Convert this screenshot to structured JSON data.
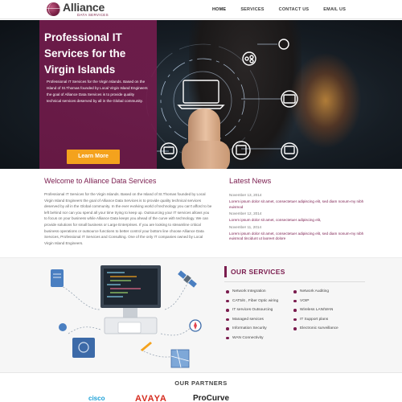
{
  "brand": {
    "name": "Alliance",
    "tagline": "DATA SERVICES",
    "accent": "#7a1c4e",
    "button_color": "#f4a21d"
  },
  "nav": {
    "items": [
      "HOME",
      "SERVICES",
      "CONTACT US",
      "EMAIL US"
    ]
  },
  "hero": {
    "title": "Professional IT Services for the Virgin Islands",
    "text": "Professional IT Services for the Virgin Islands. Based on the Island of St.Thomas founded by Local Virgin Island Engineers the goal of Alliance Data Services is to provide quality technical services deserved by all in the Global community.",
    "button": "Learn More",
    "slides": 5,
    "active_slide": 1
  },
  "welcome": {
    "title": "Welcome to Alliance Data Services",
    "text": "Professional IT Services for the Virgin Islands. Based on the Island of St.Thomas founded by Local Virgin Island Engineers the goal of Alliance Data Services is to provide quality technical services deserved by all in the Global community. In the ever evolving world of technology you can't afford to be left behind nor can you spend all your time trying to keep up. Outsourcing your IT services allows you to focus on your business while Alliance Data keeps you ahead of the curve with technology. We can provide solutions for small business or Large Enterprises. If you are looking to streamline critical business operations or outsource functions to better control your bottom line choose Alliance Data Services, Professional IT Services and Consulting. One of the only IT companies owned by Local Virgin Island Engineers."
  },
  "news": {
    "title": "Latest News",
    "items": [
      {
        "date": "November 13, 2014",
        "text": "Lorem ipsum dolor sit amet, consectetuer adipiscing elit, sed diam nonum-my nibh euismod"
      },
      {
        "date": "November 12, 2014",
        "text": "Lorem ipsum dolor sit amet, consectetuer adipiscing elit,"
      },
      {
        "date": "November 11, 2014",
        "text": "Lorem ipsum dolor sit amet, consectetuer adipiscing elit, sed diam nonum-my nibh euismod tincidunt ut laoreet dolore"
      }
    ]
  },
  "services": {
    "title": "OUR SERVICES",
    "col1": [
      "Network Integration",
      "CAT5/6 , Fiber Optic wiring",
      "IT services Outsourcing",
      "Managed services",
      "Information Security",
      "WAN Connectivity"
    ],
    "col2": [
      "Network Auditing",
      "VOIP",
      "Wireless LAN/WAN",
      "IT Support plans",
      "Electronic surveillance"
    ]
  },
  "partners": {
    "title": "OUR PARTNERS",
    "logos": [
      {
        "name": "cisco",
        "color": "#1ba0d7"
      },
      {
        "name": "AVAYA",
        "color": "#d52b1e"
      },
      {
        "name": "ProCurve",
        "color": "#222222"
      }
    ]
  }
}
